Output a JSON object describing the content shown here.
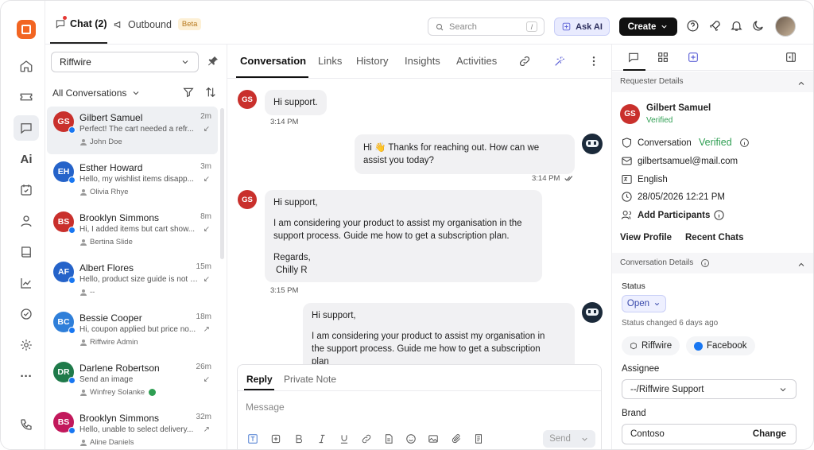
{
  "topbar": {
    "chat_tab": "Chat (2)",
    "outbound_tab": "Outbound",
    "beta_badge": "Beta",
    "search_placeholder": "Search",
    "search_shortcut": "/",
    "ask_ai": "Ask AI",
    "create": "Create"
  },
  "sidebar": {
    "ai_label": "Ai",
    "more_label": "···",
    "icons": [
      "home-icon",
      "ticket-icon",
      "chat-icon",
      "ai-icon",
      "calendar-check-icon",
      "user-icon",
      "book-icon",
      "chart-icon",
      "check-circle-icon",
      "settings-icon",
      "more-icon",
      "phone-icon"
    ]
  },
  "list": {
    "brand": "Riffwire",
    "filter_label": "All Conversations",
    "conversations": [
      {
        "initials": "GS",
        "name": "Gilbert Samuel",
        "time": "2m",
        "preview": "Perfect! The cart needed a refr...",
        "agent": "John Doe",
        "arrow": "↙",
        "color": "#c9302c"
      },
      {
        "initials": "EH",
        "name": "Esther Howard",
        "time": "3m",
        "preview": "Hello, my wishlist items disapp...",
        "agent": "Olivia Rhye",
        "arrow": "↙",
        "color": "#2563c9"
      },
      {
        "initials": "BS",
        "name": "Brooklyn Simmons",
        "time": "8m",
        "preview": "Hi, I added items but cart show...",
        "agent": "Bertina Slide",
        "arrow": "↙",
        "color": "#c9302c"
      },
      {
        "initials": "AF",
        "name": "Albert Flores",
        "time": "15m",
        "preview": "Hello, product size guide is not loa...",
        "agent": "--",
        "arrow": "↙",
        "color": "#2563c9"
      },
      {
        "initials": "BC",
        "name": "Bessie Cooper",
        "time": "18m",
        "preview": "Hi, coupon applied but price no...",
        "agent": "Riffwire Admin",
        "arrow": "↗",
        "color": "#2f7fd9"
      },
      {
        "initials": "DR",
        "name": "Darlene Robertson",
        "time": "26m",
        "preview": "Send an image",
        "agent": "Winfrey Solanke",
        "arrow": "↙",
        "color": "#1f7a4a"
      },
      {
        "initials": "BS",
        "name": "Brooklyn Simmons",
        "time": "32m",
        "preview": "Hello, unable to select delivery...",
        "agent": "Aline Daniels",
        "arrow": "↗",
        "color": "#c2185b"
      }
    ]
  },
  "conversation": {
    "tabs": [
      "Conversation",
      "Links",
      "History",
      "Insights",
      "Activities"
    ],
    "messages": {
      "m1_text": "Hi support.",
      "m1_time": "3:14 PM",
      "m1_initials": "GS",
      "m2_line1": "Hi 👋 Thanks for reaching out. How can we",
      "m2_line2": "assist you today?",
      "m2_time": "3:14 PM",
      "m3_initials": "GS",
      "m3_greeting": "Hi support,",
      "m3_body1": "I am considering your product to assist my organisation in the",
      "m3_body2": "support process. Guide me how to get a subscription plan.",
      "m3_regards": "Regards,",
      "m3_sign": "Chilly R",
      "m3_time": "3:15 PM",
      "m4_greeting": "Hi support,",
      "m4_body1": "I am considering your product to assist my organisation in",
      "m4_body2": "the support process. Guide me how to get a subscription",
      "m4_body3": "plan"
    },
    "reply": {
      "tab_reply": "Reply",
      "tab_note": "Private Note",
      "placeholder": "Message",
      "send": "Send"
    }
  },
  "details": {
    "requester_header": "Requester Details",
    "initials": "GS",
    "name": "Gilbert Samuel",
    "verified_small": "Verified",
    "conversation_label": "Conversation",
    "conversation_status": "Verified",
    "email": "gilbertsamuel@mail.com",
    "language": "English",
    "datetime": "28/05/2026 12:21 PM",
    "add_participants": "Add Participants",
    "view_profile": "View Profile",
    "recent_chats": "Recent Chats",
    "conversation_header": "Conversation Details",
    "status_label": "Status",
    "status_value": "Open",
    "status_changed": "Status changed 6 days ago",
    "chip_brand": "Riffwire",
    "chip_channel": "Facebook",
    "assignee_label": "Assignee",
    "assignee_value": "--/Riffwire Support",
    "brand_label": "Brand",
    "brand_value": "Contoso",
    "brand_change": "Change"
  },
  "colors": {
    "accent": "#f26522",
    "verified": "#2e9e52",
    "ai": "#5b5fd6"
  }
}
